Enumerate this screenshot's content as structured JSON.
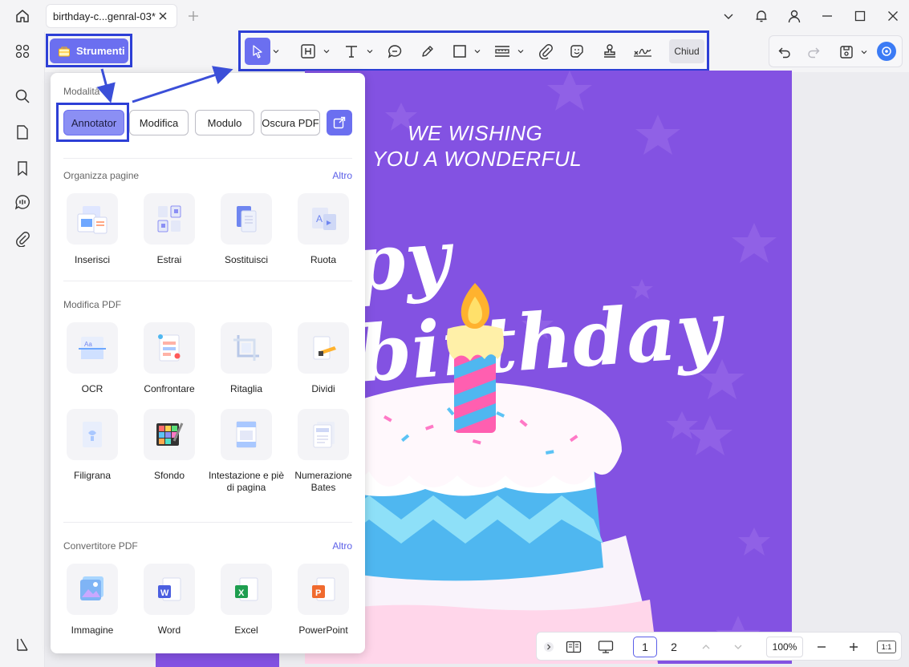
{
  "tab": {
    "title": "birthday-c...genral-03*"
  },
  "toolbar": {
    "strumenti_label": "Strumenti",
    "close_label": "Chiud"
  },
  "panel": {
    "mode_title": "Modalità",
    "modes": [
      {
        "label": "Annotator",
        "active": true
      },
      {
        "label": "Modifica",
        "active": false
      },
      {
        "label": "Modulo",
        "active": false
      },
      {
        "label": "Oscura PDF",
        "active": false
      }
    ],
    "organize": {
      "title": "Organizza pagine",
      "more": "Altro",
      "items": [
        {
          "label": "Inserisci"
        },
        {
          "label": "Estrai"
        },
        {
          "label": "Sostituisci"
        },
        {
          "label": "Ruota"
        }
      ]
    },
    "modify": {
      "title": "Modifica PDF",
      "items": [
        {
          "label": "OCR"
        },
        {
          "label": "Confrontare"
        },
        {
          "label": "Ritaglia"
        },
        {
          "label": "Dividi"
        },
        {
          "label": "Filigrana"
        },
        {
          "label": "Sfondo"
        },
        {
          "label": "Intestazione e piè di pagina"
        },
        {
          "label": "Numerazione Bates"
        }
      ]
    },
    "convert": {
      "title": "Convertitore PDF",
      "more": "Altro",
      "items": [
        {
          "label": "Immagine"
        },
        {
          "label": "Word"
        },
        {
          "label": "Excel"
        },
        {
          "label": "PowerPoint"
        }
      ]
    }
  },
  "document": {
    "line1": "WE WISHING",
    "line2": "YOU A WONDERFUL",
    "headline": "py birthday"
  },
  "nav": {
    "page1": "1",
    "page2": "2",
    "zoom": "100%",
    "fit": "1:1"
  },
  "colors": {
    "accent": "#6b6ff0",
    "highlight": "#2d3fd6",
    "page_bg": "#8352e2"
  }
}
